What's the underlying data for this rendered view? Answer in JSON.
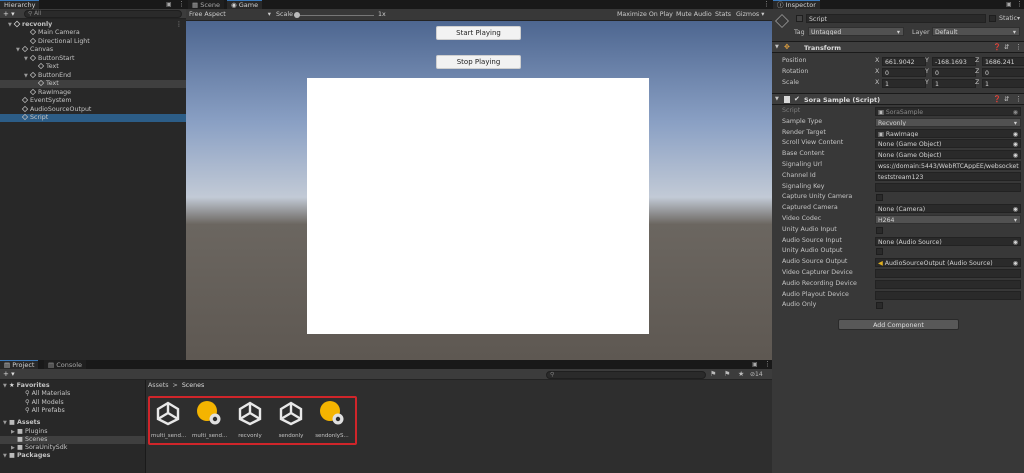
{
  "hierarchy": {
    "tab": "Hierarchy",
    "add_label": "+ ▾",
    "search_placeholder": "All",
    "items": [
      {
        "label": "recvonly",
        "indent": 0,
        "kind": "scene"
      },
      {
        "label": "Main Camera",
        "indent": 2,
        "kind": "obj"
      },
      {
        "label": "Directional Light",
        "indent": 2,
        "kind": "obj"
      },
      {
        "label": "Canvas",
        "indent": 1,
        "kind": "obj"
      },
      {
        "label": "ButtonStart",
        "indent": 2,
        "kind": "obj"
      },
      {
        "label": "Text",
        "indent": 3,
        "kind": "obj"
      },
      {
        "label": "ButtonEnd",
        "indent": 2,
        "kind": "obj"
      },
      {
        "label": "Text",
        "indent": 3,
        "kind": "obj"
      },
      {
        "label": "RawImage",
        "indent": 2,
        "kind": "obj"
      },
      {
        "label": "EventSystem",
        "indent": 1,
        "kind": "obj"
      },
      {
        "label": "AudioSourceOutput",
        "indent": 1,
        "kind": "obj"
      },
      {
        "label": "Script",
        "indent": 1,
        "kind": "obj"
      }
    ]
  },
  "game": {
    "tab_scene": "Scene",
    "tab_game": "Game",
    "aspect": "Free Aspect",
    "scale_label": "Scale",
    "scale_value": "1x",
    "maximize": "Maximize On Play",
    "mute": "Mute Audio",
    "stats": "Stats",
    "gizmos": "Gizmos",
    "start_button": "Start Playing",
    "stop_button": "Stop Playing"
  },
  "inspector": {
    "tab": "Inspector",
    "object_name": "Script",
    "static_label": "Static",
    "tag_label": "Tag",
    "tag_value": "Untagged",
    "layer_label": "Layer",
    "layer_value": "Default",
    "transform": {
      "title": "Transform",
      "position_label": "Position",
      "rotation_label": "Rotation",
      "scale_label": "Scale",
      "position": [
        "661.9042",
        "-168.1693",
        "1686.241"
      ],
      "rotation": [
        "0",
        "0",
        "0"
      ],
      "scale": [
        "1",
        "1",
        "1"
      ],
      "axis": [
        "X",
        "Y",
        "Z"
      ]
    },
    "component": {
      "title": "Sora Sample (Script)",
      "fields": [
        {
          "label": "Script",
          "value": "SoraSample",
          "type": "obj",
          "dim": true
        },
        {
          "label": "Sample Type",
          "value": "Recvonly",
          "type": "dropdown"
        },
        {
          "label": "Render Target",
          "value": "RawImage",
          "type": "obj"
        },
        {
          "label": "Scroll View Content",
          "value": "None (Game Object)",
          "type": "obj"
        },
        {
          "label": "Base Content",
          "value": "None (Game Object)",
          "type": "obj"
        },
        {
          "label": "Signaling Url",
          "value": "wss://domain:5443/WebRTCAppEE/websocket",
          "type": "text"
        },
        {
          "label": "Channel Id",
          "value": "teststream123",
          "type": "text"
        },
        {
          "label": "Signaling Key",
          "value": "",
          "type": "text"
        },
        {
          "label": "Capture Unity Camera",
          "value": "",
          "type": "check"
        },
        {
          "label": "Captured Camera",
          "value": "None (Camera)",
          "type": "obj"
        },
        {
          "label": "Video Codec",
          "value": "H264",
          "type": "dropdown"
        },
        {
          "label": "Unity Audio Input",
          "value": "",
          "type": "check"
        },
        {
          "label": "Audio Source Input",
          "value": "None (Audio Source)",
          "type": "obj"
        },
        {
          "label": "Unity Audio Output",
          "value": "",
          "type": "check"
        },
        {
          "label": "Audio Source Output",
          "value": "AudioSourceOutput (Audio Source)",
          "type": "obj"
        },
        {
          "label": "Video Capturer Device",
          "value": "",
          "type": "text"
        },
        {
          "label": "Audio Recording Device",
          "value": "",
          "type": "text"
        },
        {
          "label": "Audio Playout Device",
          "value": "",
          "type": "text"
        },
        {
          "label": "Audio Only",
          "value": "",
          "type": "check"
        }
      ]
    },
    "add_component": "Add Component"
  },
  "project": {
    "tab_project": "Project",
    "tab_console": "Console",
    "favorites_label": "Favorites",
    "favorites": [
      "All Materials",
      "All Models",
      "All Prefabs"
    ],
    "assets_label": "Assets",
    "folders": [
      "Plugins",
      "Scenes",
      "SoraUnitySdk"
    ],
    "packages_label": "Packages",
    "breadcrumb_root": "Assets",
    "breadcrumb_sep": ">",
    "breadcrumb_current": "Scenes",
    "hidden_count": "14",
    "assets": [
      {
        "label": "multi_send...",
        "kind": "unity"
      },
      {
        "label": "multi_send...",
        "kind": "script"
      },
      {
        "label": "recvonly",
        "kind": "unity"
      },
      {
        "label": "sendonly",
        "kind": "unity"
      },
      {
        "label": "sendonlyS...",
        "kind": "script"
      }
    ],
    "highlight_color": "#d0252a"
  }
}
